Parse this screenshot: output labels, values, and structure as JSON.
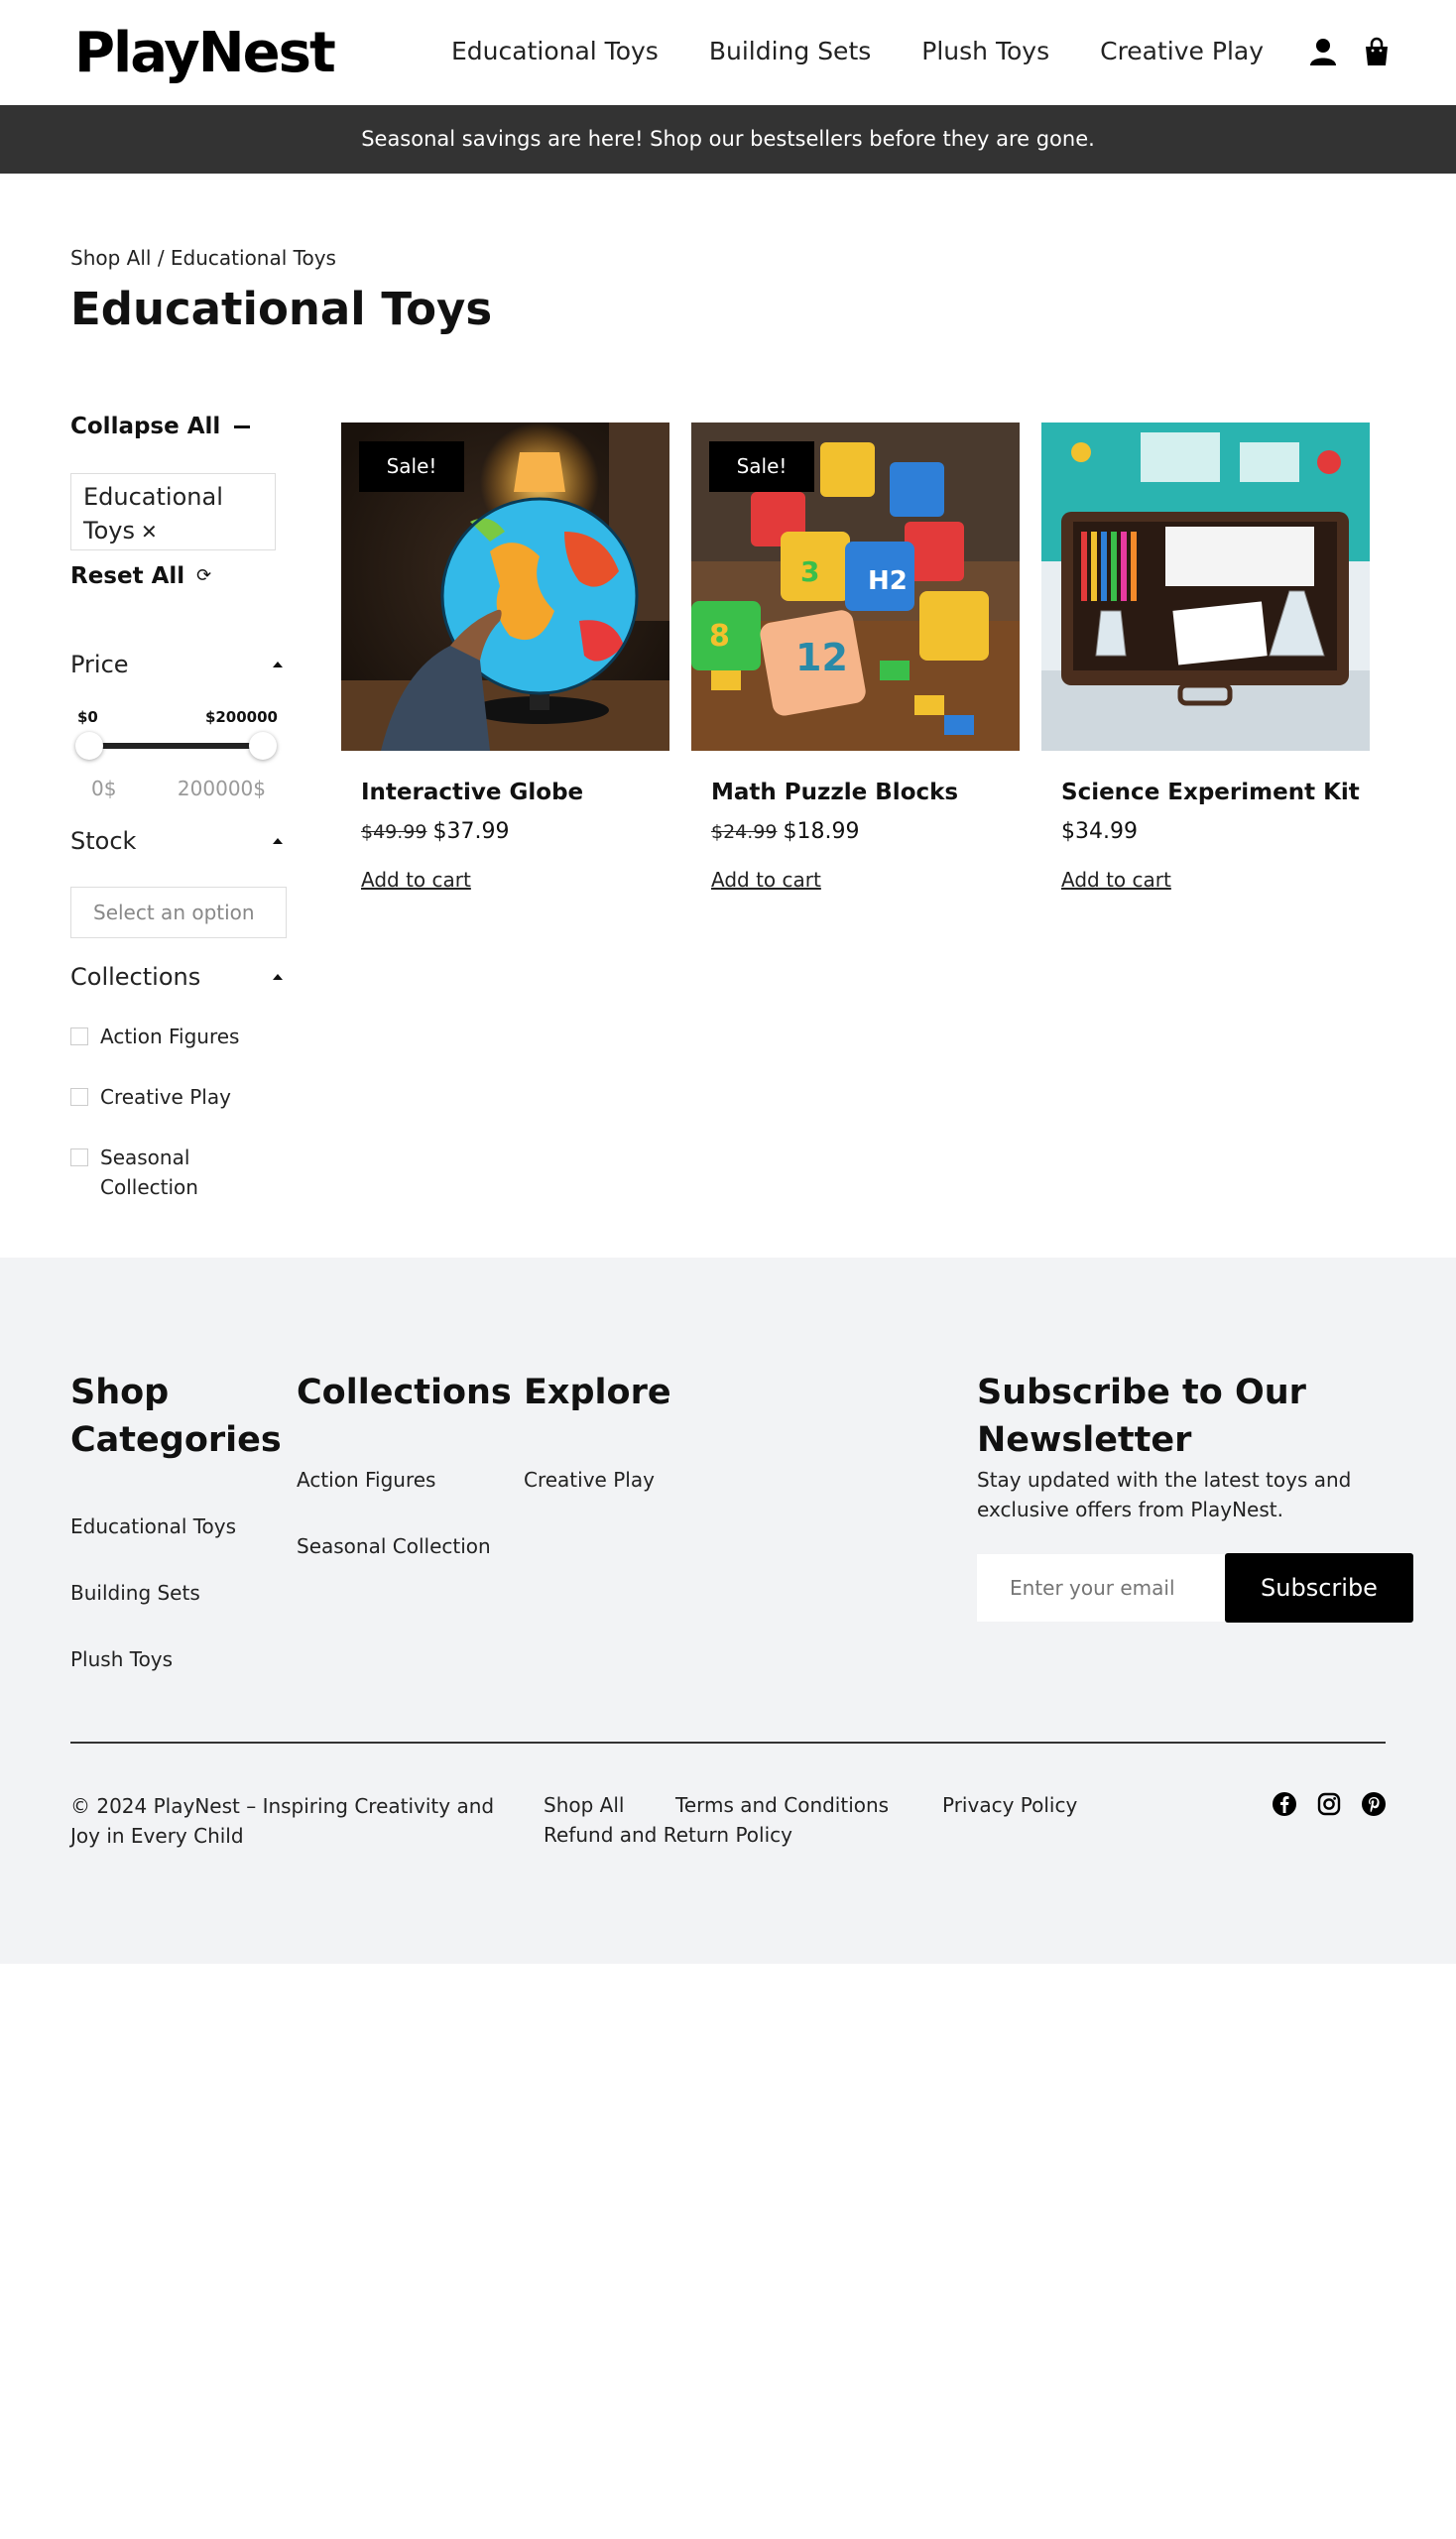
{
  "header": {
    "logo": "PlayNest",
    "nav": [
      "Educational Toys",
      "Building Sets",
      "Plush Toys",
      "Creative Play"
    ],
    "icons": [
      "user-icon",
      "shopping-bag-icon"
    ]
  },
  "announcement": "Seasonal savings are here! Shop our bestsellers before they are gone.",
  "breadcrumb": "Shop All / Educational Toys",
  "page_title": "Educational Toys",
  "sidebar": {
    "collapse_all": "Collapse All",
    "active_filter": "Educational Toys",
    "remove_symbol": "✕",
    "reset_all": "Reset All",
    "price": {
      "label": "Price",
      "min_label": "$0",
      "max_label": "$200000",
      "min_value": "0$",
      "max_value": "200000$"
    },
    "stock": {
      "label": "Stock",
      "placeholder": "Select an option"
    },
    "collections": {
      "label": "Collections",
      "items": [
        "Action Figures",
        "Creative Play",
        "Seasonal Collection"
      ]
    }
  },
  "products": [
    {
      "title": "Interactive Globe",
      "old_price": "$49.99",
      "price": "$37.99",
      "badge": "Sale!",
      "cta": "Add to cart"
    },
    {
      "title": "Math Puzzle Blocks",
      "old_price": "$24.99",
      "price": "$18.99",
      "badge": "Sale!",
      "cta": "Add to cart"
    },
    {
      "title": "Science Experiment Kit",
      "old_price": "",
      "price": "$34.99",
      "badge": "",
      "cta": "Add to cart"
    }
  ],
  "footer": {
    "shop_categories": {
      "heading": "Shop Categories",
      "links": [
        "Educational Toys",
        "Building Sets",
        "Plush Toys"
      ]
    },
    "collections": {
      "heading": "Collections",
      "links": [
        "Action Figures",
        "Seasonal Collection"
      ]
    },
    "explore": {
      "heading": "Explore",
      "links": [
        "Creative Play"
      ]
    },
    "newsletter": {
      "heading": "Subscribe to Our Newsletter",
      "text": "Stay updated with the latest toys and exclusive offers from PlayNest.",
      "placeholder": "Enter your email",
      "button": "Subscribe"
    },
    "copyright": "© 2024 PlayNest – Inspiring Creativity and Joy in Every Child",
    "bottom_links": [
      "Shop All",
      "Terms and Conditions",
      "Privacy Policy",
      "Refund and Return Policy"
    ],
    "social": [
      "facebook-icon",
      "instagram-icon",
      "pinterest-icon"
    ]
  }
}
